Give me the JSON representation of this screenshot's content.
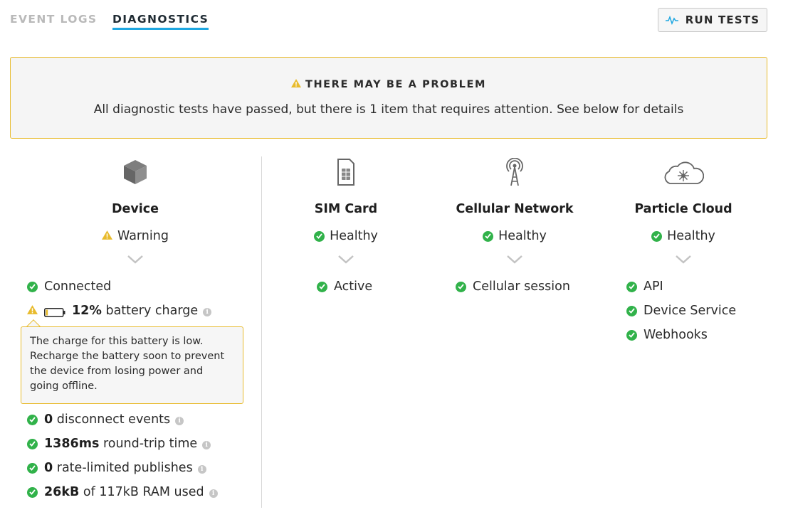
{
  "tabs": [
    {
      "label": "EVENT LOGS",
      "active": false
    },
    {
      "label": "DIAGNOSTICS",
      "active": true
    }
  ],
  "run_tests_label": "RUN TESTS",
  "alert": {
    "title": "THERE MAY BE A PROBLEM",
    "message": "All diagnostic tests have passed, but there is 1 item that requires attention. See below for details"
  },
  "colors": {
    "accent": "#1ea7e1",
    "success": "#31b24a",
    "warning": "#e8bb2d"
  },
  "device": {
    "title": "Device",
    "status": "Warning",
    "items": {
      "connected": "Connected",
      "battery_value": "12%",
      "battery_text": "battery charge",
      "battery_level": 0.12,
      "disconnect_value": "0",
      "disconnect_text": "disconnect events",
      "rtt_value": "1386ms",
      "rtt_text": "round-trip time",
      "rate_value": "0",
      "rate_text": "rate-limited publishes",
      "ram_value": "26kB",
      "ram_text": "of 117kB RAM used"
    },
    "tooltip": "The charge for this battery is low. Recharge the battery soon to prevent the device from losing power and going offline."
  },
  "sim": {
    "title": "SIM Card",
    "status": "Healthy",
    "items": [
      "Active"
    ]
  },
  "cellular": {
    "title": "Cellular Network",
    "status": "Healthy",
    "items": [
      "Cellular session"
    ]
  },
  "cloud": {
    "title": "Particle Cloud",
    "status": "Healthy",
    "items": [
      "API",
      "Device Service",
      "Webhooks"
    ]
  },
  "icons": [
    "cube-icon",
    "sim-card-icon",
    "cell-tower-icon",
    "cloud-icon",
    "check-icon",
    "warning-icon",
    "info-icon",
    "battery-icon",
    "chevron-down-icon",
    "pulse-icon"
  ]
}
